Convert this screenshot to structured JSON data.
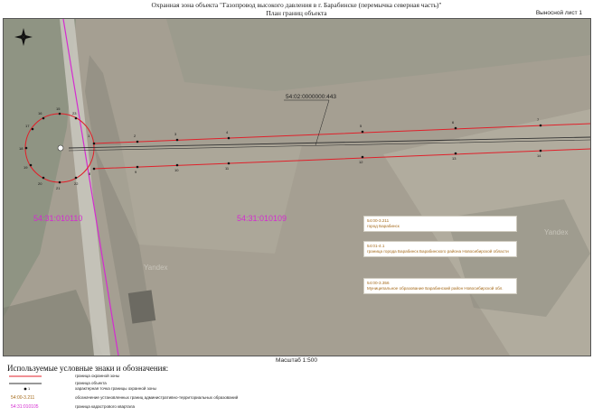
{
  "header": {
    "title_line1": "Охранная зона объекта \"Газопровод высокого давления в г. Барабинске (перемычка северная часть)\"",
    "title_line2": "План границ объекта",
    "sheet": "Выносной лист 1"
  },
  "map": {
    "cadastral_number": "54:02:0000000:443",
    "quarters": [
      "54:31:010110",
      "54:31:010109"
    ],
    "watermark": "Yandex",
    "colors": {
      "zone_border": "#e0202a",
      "object_border": "#333333",
      "quarter_border": "#d42bd0",
      "quarter_label": "#d42bd0",
      "note_text": "#a56a1b"
    },
    "point_labels": [
      "1",
      "2",
      "3",
      "4",
      "5",
      "6",
      "7",
      "8",
      "9",
      "10",
      "11",
      "12",
      "13",
      "14",
      "15",
      "16",
      "17",
      "18",
      "19",
      "20",
      "21",
      "22",
      "23",
      "24",
      "25",
      "26",
      "27",
      "28",
      "29",
      "30",
      "31",
      "32",
      "33",
      "34",
      "35"
    ],
    "notes": [
      {
        "code": "54:00-3.211",
        "text": "город Барабинск"
      },
      {
        "code": "54:01-4.1",
        "text": "граница города Барабинск Барабинского района Новосибирской области"
      },
      {
        "code": "54:00-3.356",
        "text": "Муниципальное образование Барабинский район Новосибирской обл."
      }
    ],
    "compass_icon": "north-arrow-icon"
  },
  "scale": "Масштаб 1:500",
  "legend": {
    "title": "Используемые условные знаки и обозначения:",
    "items": [
      {
        "symbol": "red-line",
        "text": "граница охранной зоны"
      },
      {
        "symbol": "black-line",
        "text": "граница объекта"
      },
      {
        "symbol": "point-1",
        "label": "1",
        "text": "характерная точка границы охранной зоны"
      },
      {
        "symbol": "code-box",
        "code": "54:00-3.211",
        "text": "обозначение установленных границ административно-территориальных образований"
      },
      {
        "symbol": "quarter-code",
        "code": "54:31:010105",
        "text": "граница кадастрового квартала"
      }
    ]
  }
}
